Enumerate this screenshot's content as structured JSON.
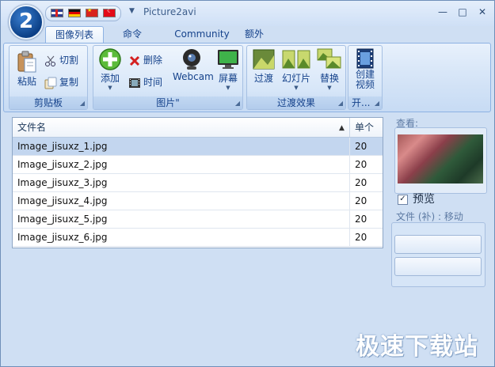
{
  "window": {
    "title": "Picture2avi",
    "app_icon_text": "2"
  },
  "tabs": [
    {
      "label": "图像列表"
    },
    {
      "label": "命令"
    },
    {
      "label": "Community"
    },
    {
      "label": "额外"
    }
  ],
  "ribbon": {
    "clipboard": {
      "label": "剪贴板",
      "paste": "粘贴",
      "cut": "切割",
      "copy": "复制"
    },
    "pictures": {
      "label": "图片\"",
      "add": "添加",
      "delete": "删除",
      "time": "时间",
      "webcam": "Webcam",
      "screen": "屏幕"
    },
    "transitions": {
      "label": "过渡效果",
      "transition": "过渡",
      "slideshow": "幻灯片",
      "replace": "替换"
    },
    "open": {
      "label": "开...",
      "create_video_line1": "创建",
      "create_video_line2": "视频"
    }
  },
  "file_list": {
    "columns": {
      "name": "文件名",
      "count": "单个"
    },
    "rows": [
      {
        "name": "Image_jisuxz_1.jpg",
        "count": "20",
        "selected": true
      },
      {
        "name": "Image_jisuxz_2.jpg",
        "count": "20"
      },
      {
        "name": "Image_jisuxz_3.jpg",
        "count": "20"
      },
      {
        "name": "Image_jisuxz_4.jpg",
        "count": "20"
      },
      {
        "name": "Image_jisuxz_5.jpg",
        "count": "20"
      },
      {
        "name": "Image_jisuxz_6.jpg",
        "count": "20"
      }
    ]
  },
  "side_panel": {
    "preview_label": "查看:",
    "preview_checkbox": "预览",
    "preview_checked": true,
    "file_label": "文件 (补) : 移动"
  },
  "watermark": "极速下载站",
  "colors": {
    "accent": "#15428b",
    "selection": "#c3d6ef",
    "ribbon_border": "#8db2e3"
  }
}
